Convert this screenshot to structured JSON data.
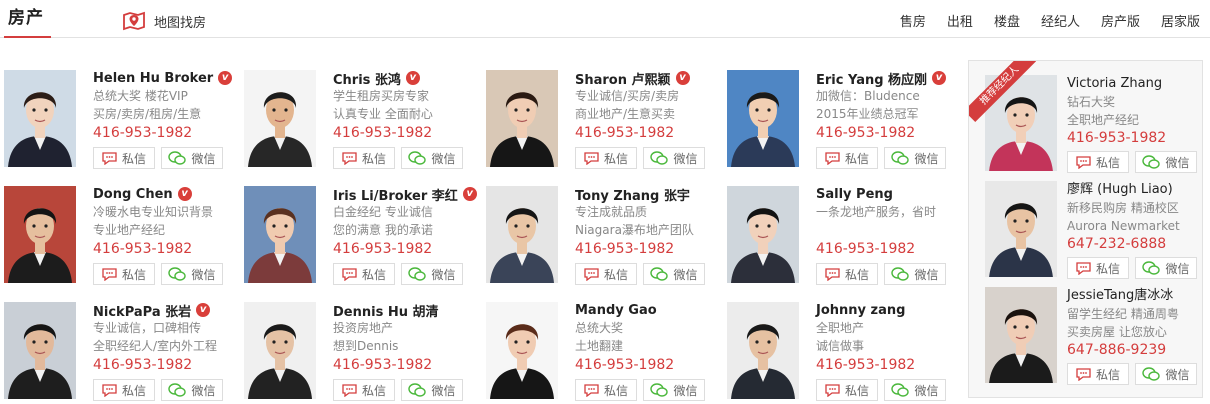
{
  "header": {
    "section_title": "房产",
    "map_link": "地图找房",
    "nav": [
      "售房",
      "出租",
      "楼盘",
      "经纪人",
      "房产版",
      "居家版"
    ]
  },
  "buttons": {
    "message": "私信",
    "wechat": "微信"
  },
  "agents": [
    {
      "name": "Helen Hu Broker",
      "verified": true,
      "lines": [
        "总统大奖 楼花VIP",
        "买房/卖房/租房/生意"
      ],
      "phone": "416-953-1982",
      "photo": {
        "bg": "#cfdbe6",
        "hair": "#2b1d17",
        "skin": "#f1d3bd",
        "shirt": "#1f2230"
      }
    },
    {
      "name": "Chris 张鸿",
      "verified": true,
      "lines": [
        "学生租房买房专家",
        "认真专业 全面耐心"
      ],
      "phone": "416-953-1982",
      "photo": {
        "bg": "#f4f4f4",
        "hair": "#1c1c1c",
        "skin": "#e3b58f",
        "shirt": "#272727"
      }
    },
    {
      "name": "Sharon 卢熙颖",
      "verified": true,
      "lines": [
        "专业诚信/买房/卖房",
        "商业地产/生意买卖"
      ],
      "phone": "416-953-1982",
      "photo": {
        "bg": "#d9c8b6",
        "hair": "#2a1a12",
        "skin": "#f0cdb4",
        "shirt": "#161616"
      }
    },
    {
      "name": "Eric Yang 杨应刚",
      "verified": true,
      "lines": [
        "加微信：Bludence",
        "2015年业绩总冠军"
      ],
      "phone": "416-953-1982",
      "photo": {
        "bg": "#4f86c4",
        "hair": "#1a1a1a",
        "skin": "#f1cfb3",
        "shirt": "#2b3a58"
      }
    },
    {
      "name": "Dong Chen",
      "verified": true,
      "lines": [
        "冷暖水电专业知识背景",
        "专业地产经纪"
      ],
      "phone": "416-953-1982",
      "photo": {
        "bg": "#b8463a",
        "hair": "#141414",
        "skin": "#e6bf9e",
        "shirt": "#1c1c1c"
      }
    },
    {
      "name": "Iris Li/Broker 李红",
      "verified": true,
      "lines": [
        "白金经纪 专业诚信",
        "您的满意 我的承诺"
      ],
      "phone": "416-953-1982",
      "photo": {
        "bg": "#6f8fb9",
        "hair": "#5a3120",
        "skin": "#f0cbb0",
        "shirt": "#7c3b3b"
      }
    },
    {
      "name": "Tony Zhang 张宇",
      "verified": false,
      "lines": [
        "专注成就品质",
        "Niagara瀑布地产团队"
      ],
      "phone": "416-953-1982",
      "photo": {
        "bg": "#e5e5e5",
        "hair": "#151515",
        "skin": "#e9c6a6",
        "shirt": "#3a4458"
      }
    },
    {
      "name": "Sally Peng",
      "verified": false,
      "lines": [
        "一条龙地产服务，省时",
        ""
      ],
      "phone": "416-953-1982",
      "photo": {
        "bg": "#cfd6dc",
        "hair": "#121212",
        "skin": "#f1d1bb",
        "shirt": "#2c2f3a"
      }
    },
    {
      "name": "NickPaPa 张岩",
      "verified": true,
      "lines": [
        "专业诚信，口碑相传",
        "全职经纪人/室内外工程"
      ],
      "phone": "416-953-1982",
      "photo": {
        "bg": "#c9cfd6",
        "hair": "#151515",
        "skin": "#e2b99b",
        "shirt": "#1e1e1e"
      }
    },
    {
      "name": "Dennis Hu 胡清",
      "verified": false,
      "lines": [
        "投资房地产",
        "想到Dennis"
      ],
      "phone": "416-953-1982",
      "photo": {
        "bg": "#f0f0f0",
        "hair": "#1a1a1a",
        "skin": "#e5c2a5",
        "shirt": "#222"
      }
    },
    {
      "name": "Mandy Gao",
      "verified": false,
      "lines": [
        "总统大奖",
        "土地翻建"
      ],
      "phone": "416-953-1982",
      "photo": {
        "bg": "#f6f6f6",
        "hair": "#5a2c1a",
        "skin": "#f0ccb3",
        "shirt": "#161616"
      }
    },
    {
      "name": "Johnny zang",
      "verified": false,
      "lines": [
        "全职地产",
        "诚信做事"
      ],
      "phone": "416-953-1982",
      "photo": {
        "bg": "#ececec",
        "hair": "#191919",
        "skin": "#e6c1a2",
        "shirt": "#252a33"
      }
    }
  ],
  "sidebar": {
    "ribbon": "推荐经纪人",
    "agents": [
      {
        "name": "Victoria Zhang",
        "lines": [
          "钻石大奖",
          "全职地产经纪"
        ],
        "phone": "416-953-1982",
        "photo": {
          "bg": "#dfe3e6",
          "hair": "#151515",
          "skin": "#f1cfb8",
          "shirt": "#c3345a"
        }
      },
      {
        "name": "廖辉 (Hugh Liao)",
        "lines": [
          "新移民购房 精通校区",
          "Aurora Newmarket"
        ],
        "phone": "647-232-6888",
        "photo": {
          "bg": "#e8e8e8",
          "hair": "#151515",
          "skin": "#e8c3a3",
          "shirt": "#2b3448"
        }
      },
      {
        "name": "JessieTang唐冰冰",
        "lines": [
          "留学生经纪 精通周粤",
          "买卖房屋  让您放心"
        ],
        "phone": "647-886-9239",
        "photo": {
          "bg": "#d8d2cc",
          "hair": "#1a120e",
          "skin": "#f0cdb6",
          "shirt": "#1b1b1b"
        }
      }
    ]
  }
}
